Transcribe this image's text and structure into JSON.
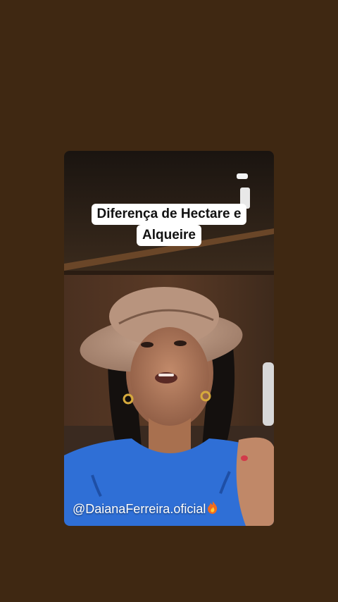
{
  "story": {
    "caption_line_1": "Diferença de Hectare  e",
    "caption_line_2": "Alqueire",
    "handle": "@DaianaFerreira.oficial"
  },
  "icons": {
    "handle_emoji": "fire-icon"
  },
  "colors": {
    "background": "#3f2812",
    "caption_bg": "#ffffff",
    "caption_text": "#111111",
    "shirt": "#2f6fd6"
  }
}
